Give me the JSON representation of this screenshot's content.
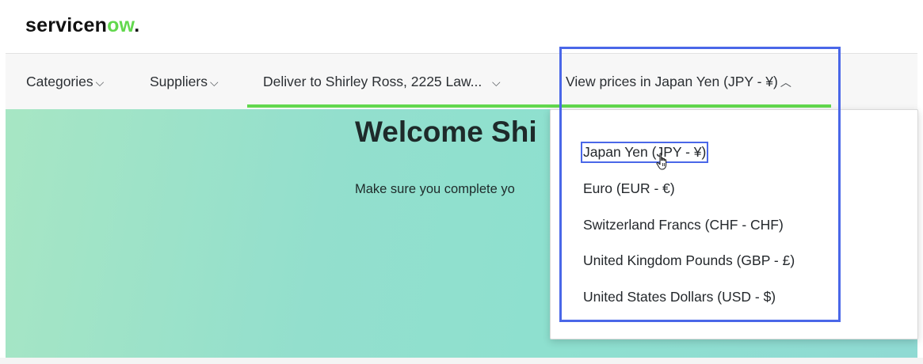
{
  "brand": {
    "logo_prefix": "servicen",
    "logo_mark": "ow",
    "logo_suffix": "."
  },
  "nav": {
    "categories": "Categories",
    "suppliers": "Suppliers",
    "deliver": "Deliver to Shirley Ross, 2225 Law...",
    "currency": "View prices in Japan Yen (JPY - ¥)",
    "chevron_down": "⌵",
    "chevron_up": "︿",
    "accent_color": "#62d84e"
  },
  "hero": {
    "title": "Welcome Shi",
    "subtitle": "Make sure you complete yo"
  },
  "currency_dropdown": {
    "selected_index": 0,
    "options": [
      "Japan Yen (JPY - ¥)",
      "Euro (EUR - €)",
      "Switzerland Francs (CHF - CHF)",
      "United Kingdom Pounds (GBP - £)",
      "United States Dollars (USD - $)"
    ],
    "highlight_color": "#4a67e8"
  },
  "icons": {
    "cursor": "hand-pointer-icon"
  }
}
